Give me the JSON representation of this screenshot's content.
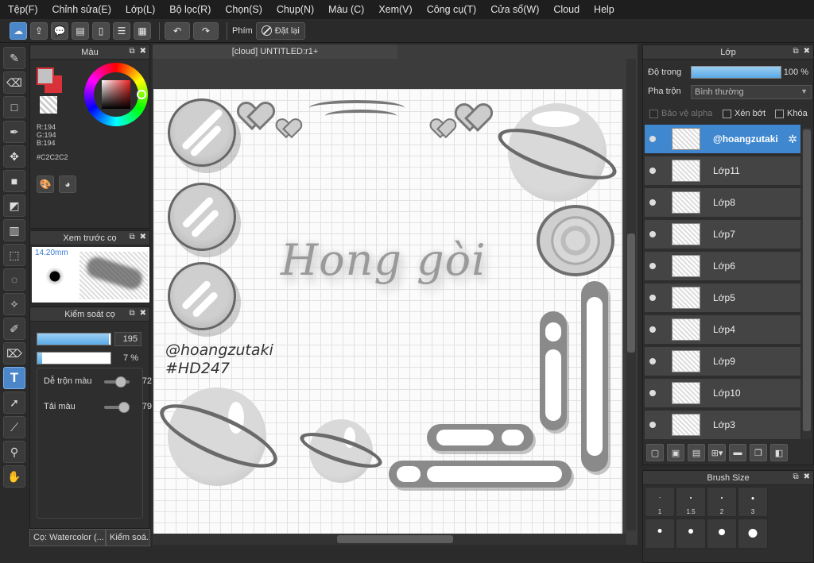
{
  "menu": [
    "Tệp(F)",
    "Chỉnh sửa(E)",
    "Lớp(L)",
    "Bộ lọc(R)",
    "Chọn(S)",
    "Chụp(N)",
    "Màu (C)",
    "Xem(V)",
    "Công cụ(T)",
    "Cửa sổ(W)",
    "Cloud",
    "Help"
  ],
  "toolbar": {
    "shortcut_label": "Phím",
    "reset_label": "Đặt lại"
  },
  "color_panel": {
    "title": "Màu",
    "r": "R:194",
    "g": "G:194",
    "b": "B:194",
    "hex": "#C2C2C2",
    "fg_color": "#C2C2C2",
    "bg_color": "#D8313A"
  },
  "brush_preview": {
    "title": "Xem trước cọ",
    "size": "14.20mm"
  },
  "brush_control": {
    "title": "Kiểm soát cọ",
    "size_value": "195",
    "size_fraction": 0.98,
    "opacity_value": "7 %",
    "opacity_fraction": 0.07,
    "blend_label": "Dễ trộn màu",
    "blend_value": "72",
    "load_label": "Tải màu",
    "load_value": "79"
  },
  "bottom_tabs": {
    "tab1": "Cọ: Watercolor (...",
    "tab2": "Kiểm soá..."
  },
  "document": {
    "tab_title": "[cloud] UNTITLED:r1+"
  },
  "artwork": {
    "title": "Hong gòi",
    "tag1": "@hoangzutaki",
    "tag2": "#HD247"
  },
  "layer_panel": {
    "title": "Lớp",
    "opacity_label": "Độ trong",
    "opacity_value": "100 %",
    "blend_label": "Pha trộn",
    "blend_value": "Bình thường",
    "protect_alpha": "Bảo vệ alpha",
    "clip": "Xén bớt",
    "lock": "Khóa",
    "layers": [
      {
        "name": "@hoangzutaki",
        "selected": true
      },
      {
        "name": "Lớp11"
      },
      {
        "name": "Lớp8"
      },
      {
        "name": "Lớp7"
      },
      {
        "name": "Lớp6"
      },
      {
        "name": "Lớp5"
      },
      {
        "name": "Lớp4"
      },
      {
        "name": "Lớp9"
      },
      {
        "name": "Lớp10"
      },
      {
        "name": "Lớp3"
      }
    ]
  },
  "brush_size_panel": {
    "title": "Brush Size",
    "sizes": [
      "1",
      "1.5",
      "2",
      "3"
    ]
  }
}
